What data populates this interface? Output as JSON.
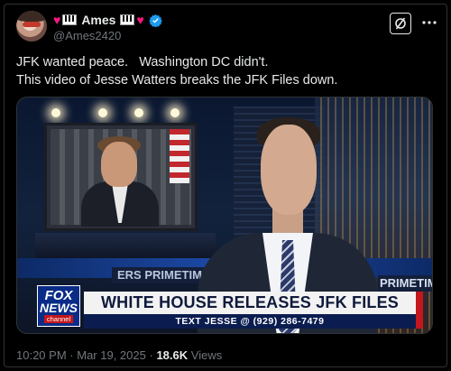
{
  "author": {
    "display_name": "Ames",
    "handle": "@Ames2420",
    "verified": true,
    "name_decorations": [
      "heart-icon",
      "piano-keys-icon",
      "piano-keys-icon",
      "heart-icon"
    ]
  },
  "header_actions": {
    "grok_icon": "grok-icon",
    "more_icon": "more-icon"
  },
  "tweet": {
    "line1": "JFK wanted peace.   Washington DC didn't.",
    "line2": "This video of Jesse Watters breaks the JFK Files down."
  },
  "media": {
    "network_logo_line1": "FOX",
    "network_logo_line2": "NEWS",
    "network_logo_line3": "channel",
    "show_tag_left": "ERS PRIMETIME",
    "show_tag_right": "PRIMETIME",
    "chyron_headline": "WHITE HOUSE RELEASES JFK FILES",
    "chyron_ticker": "TEXT JESSE @ (929) 286-7479"
  },
  "meta": {
    "time": "10:20 PM",
    "separator": "·",
    "date": "Mar 19, 2025",
    "views_count": "18.6K",
    "views_label": "Views"
  },
  "colors": {
    "background": "#000000",
    "text_primary": "#e7e9ea",
    "text_secondary": "#71767b",
    "verified_blue": "#1d9bf0",
    "heart": "#f91880"
  }
}
